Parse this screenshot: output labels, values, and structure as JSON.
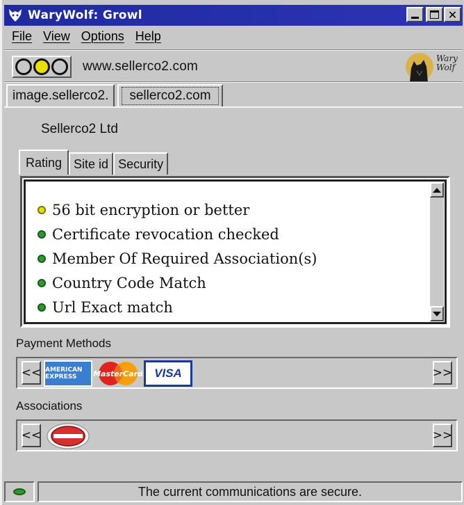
{
  "window": {
    "title": "WaryWolf: Growl",
    "controls": [
      "minimize",
      "maximize",
      "close"
    ]
  },
  "menu": {
    "items": [
      "File",
      "View",
      "Options",
      "Help"
    ]
  },
  "toolbar": {
    "traffic_lights": {
      "active": "middle",
      "active_color": "#e8df00"
    },
    "url": "www.sellerco2.com",
    "brand_text": [
      "Wary",
      "Wolf"
    ]
  },
  "site_tabs": [
    {
      "label": "image.sellerco2.",
      "selected": false
    },
    {
      "label": "sellerco2.com",
      "selected": true
    }
  ],
  "company_name": "Sellerco2 Ltd",
  "rating_tabs": [
    {
      "label": "Rating",
      "selected": true
    },
    {
      "label": "Site id",
      "selected": false
    },
    {
      "label": "Security",
      "selected": false
    }
  ],
  "rating_items": [
    {
      "text": "56 bit encryption or better",
      "status": "yellow",
      "color": "#e8df00"
    },
    {
      "text": "Certificate revocation checked",
      "status": "green",
      "color": "#2c9a2c"
    },
    {
      "text": "Member Of Required Association(s)",
      "status": "green",
      "color": "#2c9a2c"
    },
    {
      "text": "Country Code Match",
      "status": "green",
      "color": "#2c9a2c"
    },
    {
      "text": "Url Exact match",
      "status": "green",
      "color": "#2c9a2c"
    }
  ],
  "payment_methods": {
    "label": "Payment Methods",
    "prev": "<<",
    "next": ">>",
    "cards": [
      "AMERICAN EXPRESS",
      "MasterCard",
      "VISA"
    ]
  },
  "associations": {
    "label": "Associations",
    "prev": "<<",
    "next": ">>"
  },
  "status": {
    "text": "The current communications are secure.",
    "led_color": "#2c9a2c"
  }
}
